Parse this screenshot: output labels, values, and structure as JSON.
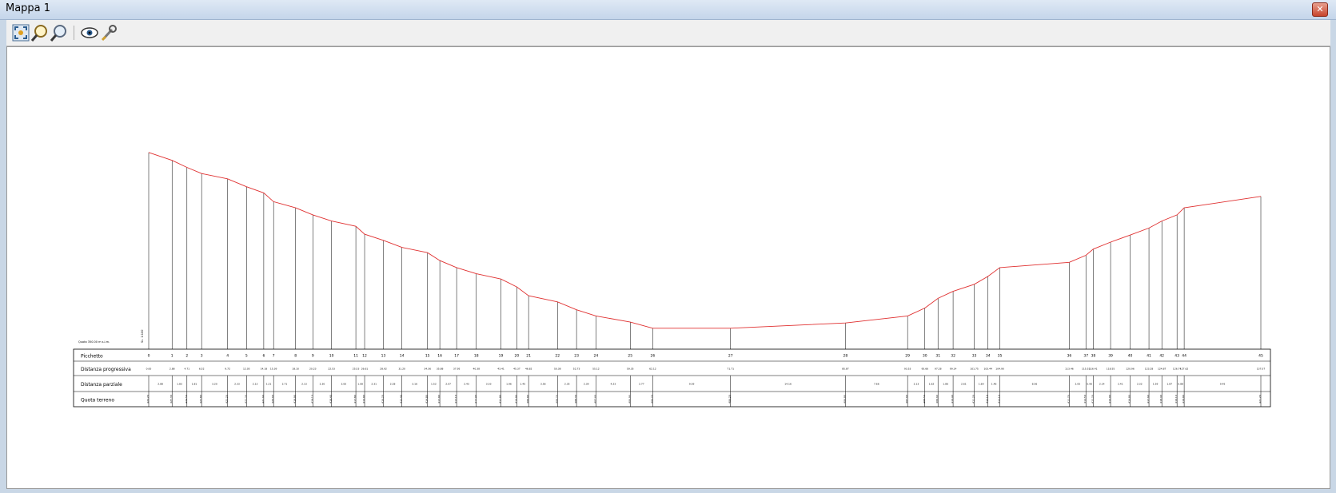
{
  "window": {
    "title": "Mappa 1",
    "close_label": "✕"
  },
  "toolbar": {
    "buttons": [
      {
        "name": "zoom-full-button",
        "icon": "zoom-full-icon"
      },
      {
        "name": "zoom-in-button",
        "icon": "zoom-in-icon"
      },
      {
        "name": "zoom-out-button",
        "icon": "zoom-out-icon"
      },
      {
        "name": "view-button",
        "icon": "eye-icon"
      },
      {
        "name": "settings-button",
        "icon": "wrench-icon"
      }
    ]
  },
  "profile": {
    "scale_label": "Quota 350.00 m s.l.m.",
    "scale_label_small": "Sc. 1:100",
    "row_labels": {
      "picchetto": "Picchetto",
      "progressive": "Distanza progressiva",
      "parziale": "Distanza parziale",
      "quota": "Quota terreno"
    },
    "stations": [
      {
        "id": "0",
        "prog": "0.00",
        "part": "2.88",
        "quota": "426.20"
      },
      {
        "id": "1",
        "prog": "2.88",
        "part": "1.83",
        "quota": "425.30"
      },
      {
        "id": "2",
        "prog": "4.71",
        "part": "1.81",
        "quota": "424.50"
      },
      {
        "id": "3",
        "prog": "6.52",
        "part": "3.20",
        "quota": "423.80"
      },
      {
        "id": "4",
        "prog": "9.72",
        "part": "2.33",
        "quota": "423.20"
      },
      {
        "id": "5",
        "prog": "12.05",
        "part": "2.13",
        "quota": "422.30"
      },
      {
        "id": "6",
        "prog": "14.18",
        "part": "1.21",
        "quota": "421.60"
      },
      {
        "id": "7",
        "prog": "15.39",
        "part": "2.71",
        "quota": "420.60"
      },
      {
        "id": "8",
        "prog": "18.10",
        "part": "2.13",
        "quota": "419.90"
      },
      {
        "id": "9",
        "prog": "20.23",
        "part": "2.30",
        "quota": "419.10"
      },
      {
        "id": "10",
        "prog": "22.53",
        "part": "3.00",
        "quota": "418.40"
      },
      {
        "id": "11",
        "prog": "25.53",
        "part": "1.08",
        "quota": "417.80"
      },
      {
        "id": "12",
        "prog": "26.61",
        "part": "2.31",
        "quota": "416.90"
      },
      {
        "id": "13",
        "prog": "28.92",
        "part": "2.28",
        "quota": "416.20"
      },
      {
        "id": "14",
        "prog": "31.20",
        "part": "3.16",
        "quota": "415.40"
      },
      {
        "id": "15",
        "prog": "34.36",
        "part": "1.52",
        "quota": "414.80"
      },
      {
        "id": "16",
        "prog": "35.88",
        "part": "2.07",
        "quota": "413.90"
      },
      {
        "id": "17",
        "prog": "37.95",
        "part": "2.43",
        "quota": "413.10"
      },
      {
        "id": "18",
        "prog": "40.38",
        "part": "3.03",
        "quota": "412.40"
      },
      {
        "id": "19",
        "prog": "43.41",
        "part": "1.96",
        "quota": "411.80"
      },
      {
        "id": "20",
        "prog": "45.37",
        "part": "1.45",
        "quota": "410.90"
      },
      {
        "id": "21",
        "prog": "46.82",
        "part": "3.56",
        "quota": "409.90"
      },
      {
        "id": "22",
        "prog": "50.38",
        "part": "2.35",
        "quota": "409.20"
      },
      {
        "id": "23",
        "prog": "52.73",
        "part": "2.39",
        "quota": "408.30"
      },
      {
        "id": "24",
        "prog": "55.12",
        "part": "4.23",
        "quota": "407.60"
      },
      {
        "id": "25",
        "prog": "59.35",
        "part": "2.77",
        "quota": "406.90"
      },
      {
        "id": "26",
        "prog": "62.12",
        "part": "9.59",
        "quota": "406.20"
      },
      {
        "id": "27",
        "prog": "71.71",
        "part": "14.16",
        "quota": "406.20"
      },
      {
        "id": "28",
        "prog": "85.87",
        "part": "7.66",
        "quota": "406.80"
      },
      {
        "id": "29",
        "prog": "93.53",
        "part": "2.13",
        "quota": "407.60"
      },
      {
        "id": "30",
        "prog": "95.66",
        "part": "1.62",
        "quota": "408.50"
      },
      {
        "id": "31",
        "prog": "97.28",
        "part": "1.86",
        "quota": "409.60"
      },
      {
        "id": "32",
        "prog": "99.14",
        "part": "2.61",
        "quota": "410.40"
      },
      {
        "id": "33",
        "prog": "101.75",
        "part": "1.69",
        "quota": "411.20"
      },
      {
        "id": "34",
        "prog": "103.44",
        "part": "1.46",
        "quota": "412.10"
      },
      {
        "id": "35",
        "prog": "104.90",
        "part": "8.56",
        "quota": "413.10"
      },
      {
        "id": "36",
        "prog": "113.46",
        "part": "2.05",
        "quota": "413.70"
      },
      {
        "id": "37",
        "prog": "115.51",
        "part": "0.90",
        "quota": "414.50"
      },
      {
        "id": "38",
        "prog": "116.41",
        "part": "2.14",
        "quota": "415.20"
      },
      {
        "id": "39",
        "prog": "118.55",
        "part": "2.41",
        "quota": "416.00"
      },
      {
        "id": "40",
        "prog": "120.96",
        "part": "2.32",
        "quota": "416.80"
      },
      {
        "id": "41",
        "prog": "123.28",
        "part": "1.59",
        "quota": "417.60"
      },
      {
        "id": "42",
        "prog": "124.87",
        "part": "1.87",
        "quota": "418.40"
      },
      {
        "id": "43",
        "prog": "126.74",
        "part": "0.88",
        "quota": "419.10"
      },
      {
        "id": "44",
        "prog": "127.62",
        "part": "9.45",
        "quota": "419.90"
      },
      {
        "id": "45",
        "prog": "137.07",
        "part": "",
        "quota": "421.20"
      }
    ]
  }
}
